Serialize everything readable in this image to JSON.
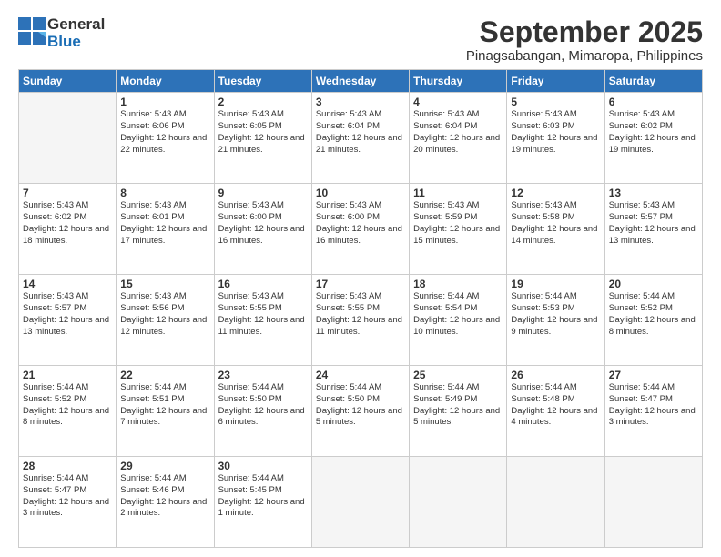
{
  "header": {
    "logo_general": "General",
    "logo_blue": "Blue",
    "title": "September 2025",
    "subtitle": "Pinagsabangan, Mimaropa, Philippines"
  },
  "calendar": {
    "columns": [
      "Sunday",
      "Monday",
      "Tuesday",
      "Wednesday",
      "Thursday",
      "Friday",
      "Saturday"
    ],
    "weeks": [
      [
        {
          "day": "",
          "empty": true
        },
        {
          "day": "1",
          "sunrise": "5:43 AM",
          "sunset": "6:06 PM",
          "daylight": "12 hours and 22 minutes."
        },
        {
          "day": "2",
          "sunrise": "5:43 AM",
          "sunset": "6:05 PM",
          "daylight": "12 hours and 21 minutes."
        },
        {
          "day": "3",
          "sunrise": "5:43 AM",
          "sunset": "6:04 PM",
          "daylight": "12 hours and 21 minutes."
        },
        {
          "day": "4",
          "sunrise": "5:43 AM",
          "sunset": "6:04 PM",
          "daylight": "12 hours and 20 minutes."
        },
        {
          "day": "5",
          "sunrise": "5:43 AM",
          "sunset": "6:03 PM",
          "daylight": "12 hours and 19 minutes."
        },
        {
          "day": "6",
          "sunrise": "5:43 AM",
          "sunset": "6:02 PM",
          "daylight": "12 hours and 19 minutes."
        }
      ],
      [
        {
          "day": "7",
          "sunrise": "5:43 AM",
          "sunset": "6:02 PM",
          "daylight": "12 hours and 18 minutes."
        },
        {
          "day": "8",
          "sunrise": "5:43 AM",
          "sunset": "6:01 PM",
          "daylight": "12 hours and 17 minutes."
        },
        {
          "day": "9",
          "sunrise": "5:43 AM",
          "sunset": "6:00 PM",
          "daylight": "12 hours and 16 minutes."
        },
        {
          "day": "10",
          "sunrise": "5:43 AM",
          "sunset": "6:00 PM",
          "daylight": "12 hours and 16 minutes."
        },
        {
          "day": "11",
          "sunrise": "5:43 AM",
          "sunset": "5:59 PM",
          "daylight": "12 hours and 15 minutes."
        },
        {
          "day": "12",
          "sunrise": "5:43 AM",
          "sunset": "5:58 PM",
          "daylight": "12 hours and 14 minutes."
        },
        {
          "day": "13",
          "sunrise": "5:43 AM",
          "sunset": "5:57 PM",
          "daylight": "12 hours and 13 minutes."
        }
      ],
      [
        {
          "day": "14",
          "sunrise": "5:43 AM",
          "sunset": "5:57 PM",
          "daylight": "12 hours and 13 minutes."
        },
        {
          "day": "15",
          "sunrise": "5:43 AM",
          "sunset": "5:56 PM",
          "daylight": "12 hours and 12 minutes."
        },
        {
          "day": "16",
          "sunrise": "5:43 AM",
          "sunset": "5:55 PM",
          "daylight": "12 hours and 11 minutes."
        },
        {
          "day": "17",
          "sunrise": "5:43 AM",
          "sunset": "5:55 PM",
          "daylight": "12 hours and 11 minutes."
        },
        {
          "day": "18",
          "sunrise": "5:44 AM",
          "sunset": "5:54 PM",
          "daylight": "12 hours and 10 minutes."
        },
        {
          "day": "19",
          "sunrise": "5:44 AM",
          "sunset": "5:53 PM",
          "daylight": "12 hours and 9 minutes."
        },
        {
          "day": "20",
          "sunrise": "5:44 AM",
          "sunset": "5:52 PM",
          "daylight": "12 hours and 8 minutes."
        }
      ],
      [
        {
          "day": "21",
          "sunrise": "5:44 AM",
          "sunset": "5:52 PM",
          "daylight": "12 hours and 8 minutes."
        },
        {
          "day": "22",
          "sunrise": "5:44 AM",
          "sunset": "5:51 PM",
          "daylight": "12 hours and 7 minutes."
        },
        {
          "day": "23",
          "sunrise": "5:44 AM",
          "sunset": "5:50 PM",
          "daylight": "12 hours and 6 minutes."
        },
        {
          "day": "24",
          "sunrise": "5:44 AM",
          "sunset": "5:50 PM",
          "daylight": "12 hours and 5 minutes."
        },
        {
          "day": "25",
          "sunrise": "5:44 AM",
          "sunset": "5:49 PM",
          "daylight": "12 hours and 5 minutes."
        },
        {
          "day": "26",
          "sunrise": "5:44 AM",
          "sunset": "5:48 PM",
          "daylight": "12 hours and 4 minutes."
        },
        {
          "day": "27",
          "sunrise": "5:44 AM",
          "sunset": "5:47 PM",
          "daylight": "12 hours and 3 minutes."
        }
      ],
      [
        {
          "day": "28",
          "sunrise": "5:44 AM",
          "sunset": "5:47 PM",
          "daylight": "12 hours and 3 minutes."
        },
        {
          "day": "29",
          "sunrise": "5:44 AM",
          "sunset": "5:46 PM",
          "daylight": "12 hours and 2 minutes."
        },
        {
          "day": "30",
          "sunrise": "5:44 AM",
          "sunset": "5:45 PM",
          "daylight": "12 hours and 1 minute."
        },
        {
          "day": "",
          "empty": true
        },
        {
          "day": "",
          "empty": true
        },
        {
          "day": "",
          "empty": true
        },
        {
          "day": "",
          "empty": true
        }
      ]
    ]
  }
}
